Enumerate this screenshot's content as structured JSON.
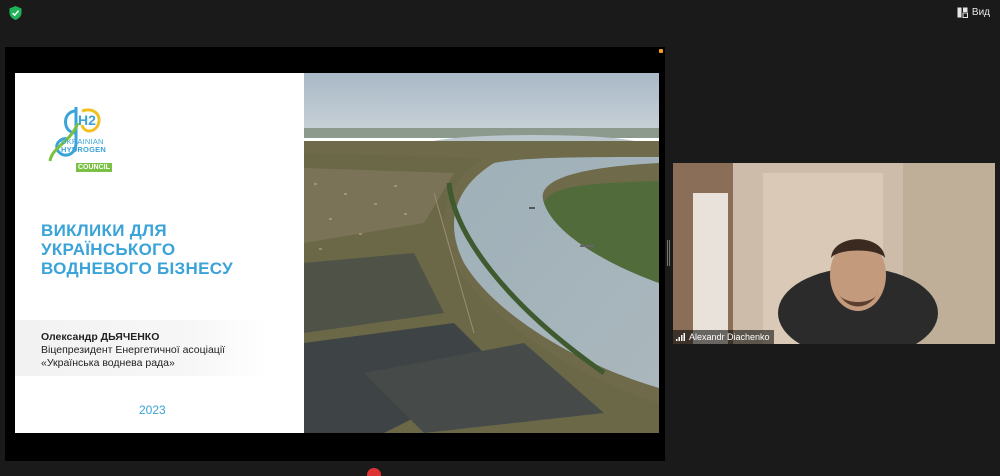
{
  "toolbar": {
    "view_label": "Вид"
  },
  "slide": {
    "logo": {
      "line1": "UKRAINIAN",
      "line2": "HYDROGEN",
      "line3": "COUNCIL",
      "mark": "H2"
    },
    "title_lines": [
      "ВИКЛИКИ ДЛЯ",
      "УКРАЇНСЬКОГО",
      "ВОДНЕВОГО БІЗНЕСУ"
    ],
    "author_name": "Олександр ДЬЯЧЕНКО",
    "author_role_1": "Віцепрезидент Енергетичної асоціації",
    "author_role_2": "«Українська воднева рада»",
    "year": "2023"
  },
  "participant": {
    "name": "Alexandr Diachenko"
  },
  "colors": {
    "brand_blue": "#3aa3d8",
    "brand_green": "#7ac143",
    "background": "#1a1a1a"
  }
}
